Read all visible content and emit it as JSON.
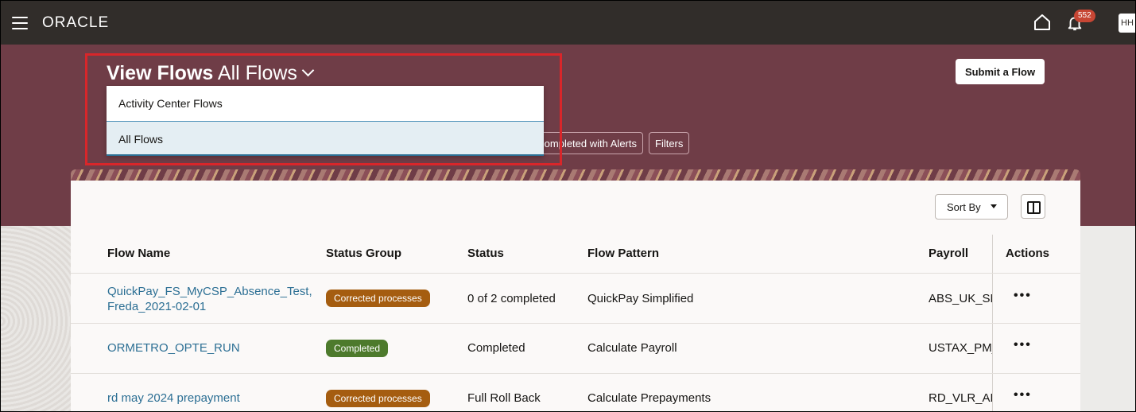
{
  "header": {
    "logo": "ORACLE",
    "notification_count": "552",
    "user_initials": "HH"
  },
  "page": {
    "title_bold": "View Flows",
    "title_view": "All Flows",
    "submit_label": "Submit a Flow"
  },
  "dropdown": {
    "options": [
      {
        "label": "Activity Center Flows",
        "selected": false
      },
      {
        "label": "All Flows",
        "selected": true
      }
    ]
  },
  "chips": {
    "completed_with_alerts": "Completed with Alerts",
    "filters": "Filters"
  },
  "toolbar": {
    "sort_label": "Sort By"
  },
  "table": {
    "columns": [
      "Flow Name",
      "Status Group",
      "Status",
      "Flow Pattern",
      "Payroll",
      "Actions"
    ],
    "rows": [
      {
        "flow_name_line1": "QuickPay_FS_MyCSP_Absence_Test,",
        "flow_name_line2": "Freda_2021-02-01",
        "status_group": "Corrected processes",
        "status": "0 of 2 completed",
        "flow_pattern": "QuickPay Simplified",
        "payroll": "ABS_UK_SM",
        "actions": "•••"
      },
      {
        "flow_name_line1": "ORMETRO_OPTE_RUN",
        "status_group": "Completed",
        "status": "Completed",
        "flow_pattern": "Calculate Payroll",
        "payroll": "USTAX_PM_",
        "actions": "•••"
      },
      {
        "flow_name_line1": "rd may 2024 prepayment",
        "status_group": "Corrected processes",
        "status": "Full Roll Back",
        "flow_pattern": "Calculate Prepayments",
        "payroll": "RD_VLR_ALI",
        "actions": "•••"
      }
    ]
  },
  "colors": {
    "topbar": "#312d2a",
    "banner": "#6f3d47",
    "link": "#2c6f94",
    "pill_orange": "#a55d10",
    "pill_green": "#4d7a2c",
    "highlight": "#d9262a"
  }
}
